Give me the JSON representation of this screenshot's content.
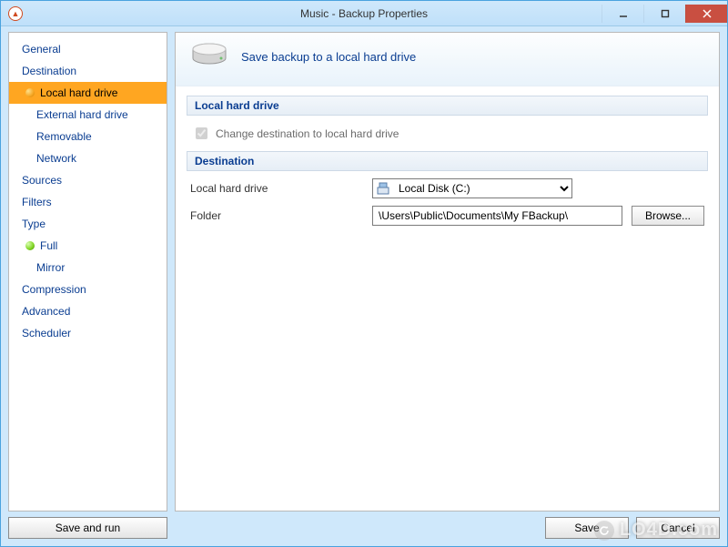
{
  "window": {
    "title": "Music - Backup Properties",
    "icon": "app-icon"
  },
  "sidebar": {
    "items": [
      {
        "label": "General",
        "kind": "top"
      },
      {
        "label": "Destination",
        "kind": "top"
      },
      {
        "label": "Local hard drive",
        "kind": "sub",
        "selected": true,
        "dot": "orange"
      },
      {
        "label": "External hard drive",
        "kind": "sub"
      },
      {
        "label": "Removable",
        "kind": "sub"
      },
      {
        "label": "Network",
        "kind": "sub"
      },
      {
        "label": "Sources",
        "kind": "top"
      },
      {
        "label": "Filters",
        "kind": "top"
      },
      {
        "label": "Type",
        "kind": "top"
      },
      {
        "label": "Full",
        "kind": "sub",
        "dot": "green"
      },
      {
        "label": "Mirror",
        "kind": "sub"
      },
      {
        "label": "Compression",
        "kind": "top"
      },
      {
        "label": "Advanced",
        "kind": "top"
      },
      {
        "label": "Scheduler",
        "kind": "top"
      }
    ]
  },
  "main": {
    "hero_text": "Save backup to a local hard drive",
    "section1_title": "Local hard drive",
    "change_dest_label": "Change destination to local hard drive",
    "change_dest_checked": true,
    "section2_title": "Destination",
    "drive_label": "Local hard drive",
    "drive_value": "Local Disk (C:)",
    "folder_label": "Folder",
    "folder_value": "\\Users\\Public\\Documents\\My FBackup\\",
    "browse_label": "Browse..."
  },
  "footer": {
    "save_run": "Save and run",
    "save": "Save",
    "cancel": "Cancel"
  },
  "watermark": "LO4D.com"
}
